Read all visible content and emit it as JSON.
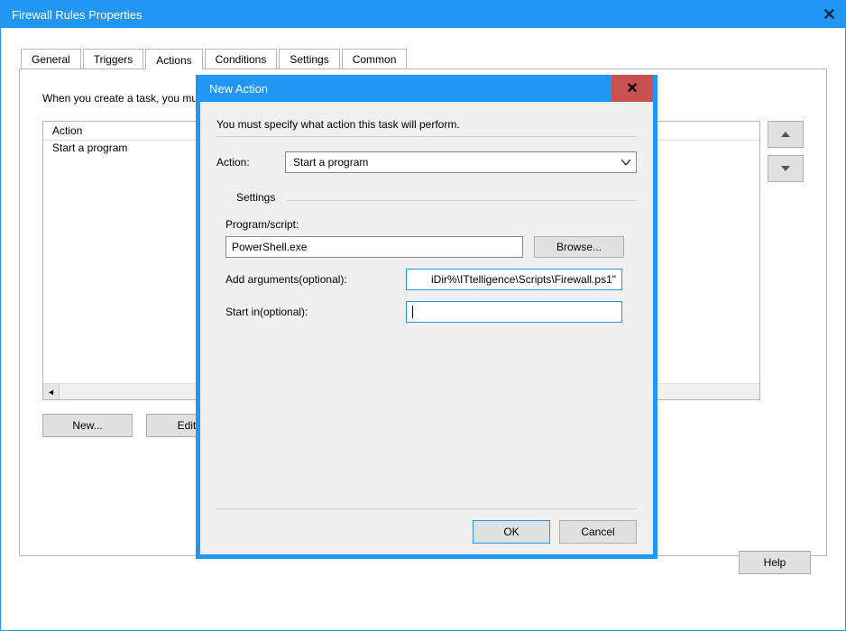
{
  "outer": {
    "title": "Firewall Rules Properties",
    "tabs": [
      "General",
      "Triggers",
      "Actions",
      "Conditions",
      "Settings",
      "Common"
    ],
    "active_tab_index": 2,
    "intro": "When you create a task, you must specify the action that will occur when your task starts.",
    "list": {
      "header": "Action",
      "rows": [
        "Start a program"
      ]
    },
    "buttons": {
      "new": "New...",
      "edit": "Edit...",
      "help": "Help"
    }
  },
  "modal": {
    "title": "New Action",
    "instruction": "You must specify what action this task will perform.",
    "action_label": "Action:",
    "action_value": "Start a program",
    "settings_label": "Settings",
    "program_label": "Program/script:",
    "program_value": "PowerShell.exe",
    "browse_label": "Browse...",
    "args_label": "Add arguments(optional):",
    "args_value": "iDir%\\ITtelligence\\Scripts\\Firewall.ps1\"",
    "startin_label": "Start in(optional):",
    "startin_value": "",
    "ok_label": "OK",
    "cancel_label": "Cancel"
  }
}
